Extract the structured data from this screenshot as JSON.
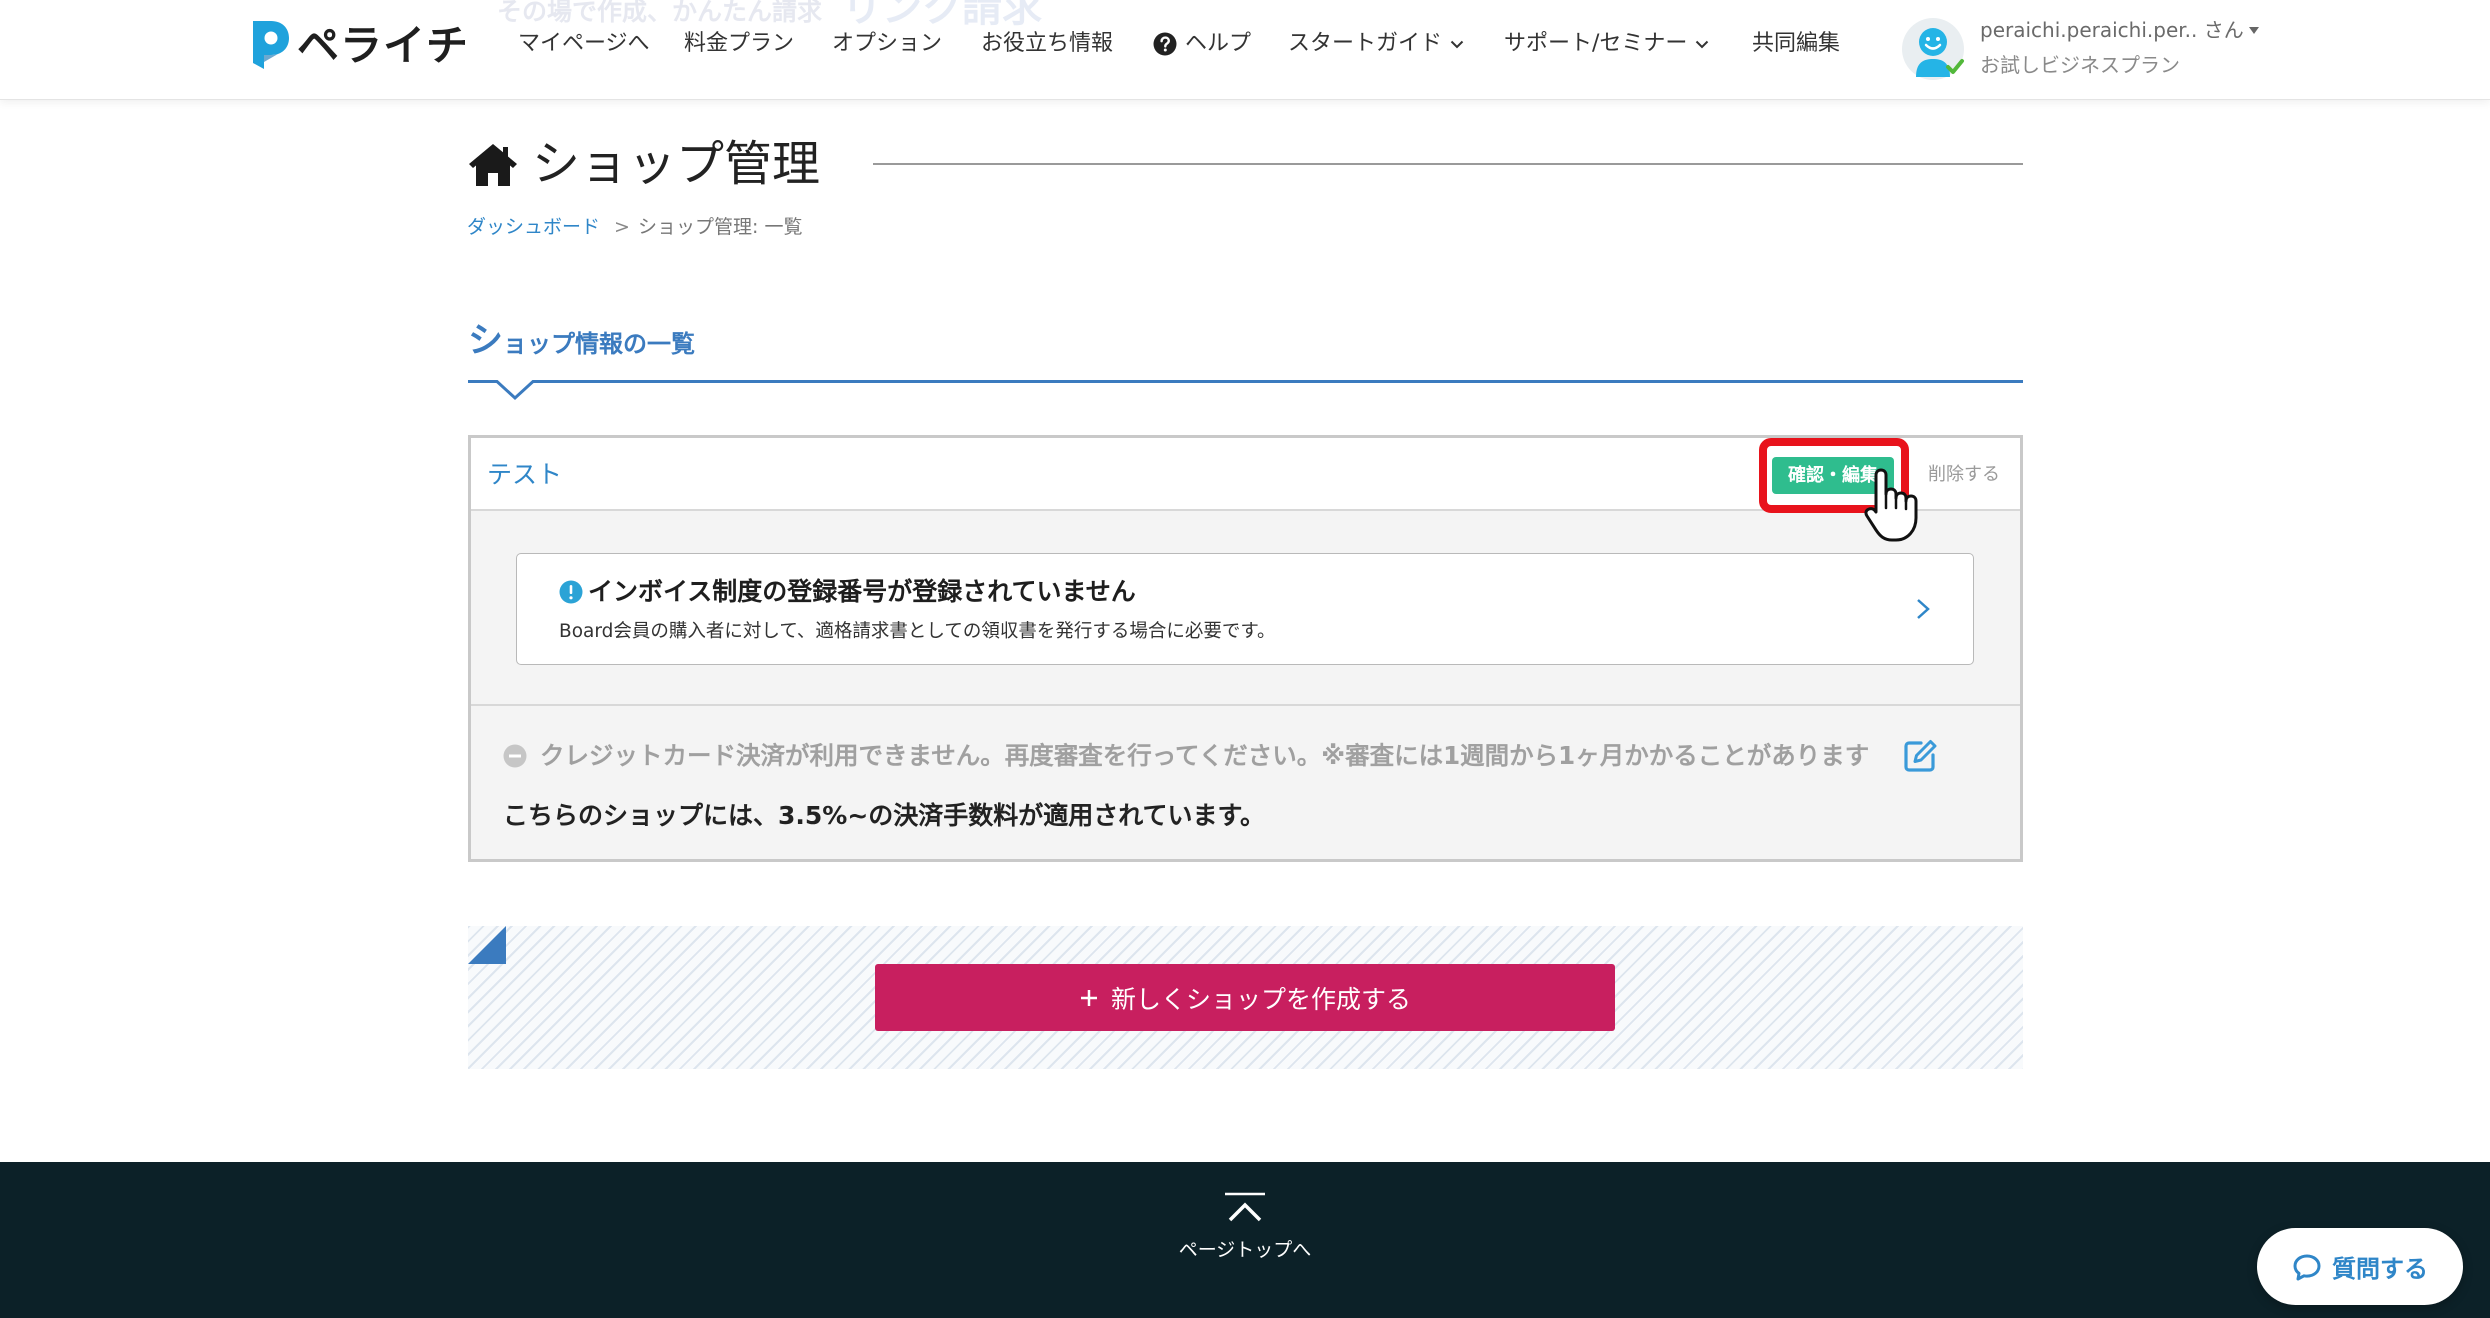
{
  "banner": {
    "tagline": "その場で作成、かんたん請求",
    "feature": "リンク請求"
  },
  "header": {
    "logo": {
      "text": "ペライチ",
      "icon": "peraichi-p-logo-icon"
    },
    "nav": [
      {
        "label": "マイページへ"
      },
      {
        "label": "料金プラン"
      },
      {
        "label": "オプション"
      },
      {
        "label": "お役立ち情報"
      },
      {
        "label": "ヘルプ",
        "icon": "help-circle-icon"
      },
      {
        "label": "スタートガイド",
        "icon": "chevron-down-icon"
      },
      {
        "label": "サポート/セミナー",
        "icon": "chevron-down-icon"
      },
      {
        "label": "共同編集"
      }
    ],
    "user": {
      "name": "peraichi.peraichi.per.. さん",
      "plan": "お試しビジネスプラン",
      "avatar_icon": "smiley-avatar-icon",
      "status_icon": "green-check-icon",
      "menu_icon": "caret-down-icon"
    }
  },
  "page": {
    "title": "ショップ管理",
    "title_icon": "home-icon"
  },
  "breadcrumb": {
    "items": [
      {
        "label": "ダッシュボード"
      },
      {
        "label": "ショップ管理: 一覧"
      }
    ],
    "separator": ">"
  },
  "section": {
    "heading": "ショップ情報の一覧"
  },
  "shops": [
    {
      "name": "テスト",
      "edit_label": "確認・編集",
      "delete_label": "削除する",
      "notice": {
        "icon": "info-circle-icon",
        "title": "インボイス制度の登録番号が登録されていません",
        "description": "Board会員の購入者に対して、適格請求書としての領収書を発行する場合に必要です。",
        "action_icon": "chevron-right-icon"
      },
      "credit_status": {
        "icon": "minus-circle-icon",
        "text": "クレジットカード決済が利用できません。再度審査を行ってください。※審査には1週間から1ヶ月かかることがあります",
        "action_icon": "edit-icon"
      },
      "fee_note": "こちらのショップには、3.5%~の決済手数料が適用されています。"
    }
  ],
  "create": {
    "label": "新しくショップを作成する",
    "icon": "plus-icon"
  },
  "footer": {
    "page_top_label": "ページトップへ",
    "page_top_icon": "chevron-up-icon"
  },
  "chat": {
    "label": "質問する",
    "icon": "chat-bubble-icon"
  },
  "annotation": {
    "highlight": "red-highlight-box",
    "cursor": "hand-pointer-icon"
  },
  "colors": {
    "brand_blue": "#3b7bbf",
    "link_blue": "#2f86c8",
    "edit_green": "#2fbd8e",
    "create_pink": "#c81f5f",
    "highlight_red": "#e8131c",
    "footer_bg": "#0c2128"
  }
}
